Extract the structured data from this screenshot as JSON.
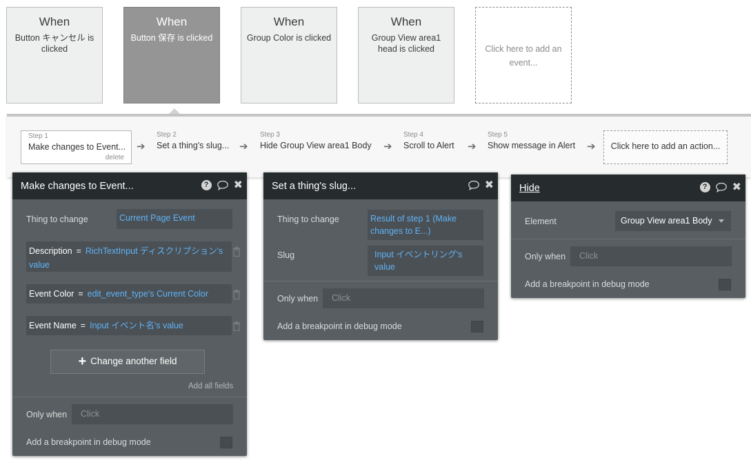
{
  "events": [
    {
      "when": "When",
      "desc": "Button キャンセル is clicked"
    },
    {
      "when": "When",
      "desc": "Button 保存 is clicked"
    },
    {
      "when": "When",
      "desc": "Group Color is clicked"
    },
    {
      "when": "When",
      "desc": "Group View area1 head is clicked"
    },
    {
      "when": "",
      "desc": "Click here to add an event..."
    }
  ],
  "steps": [
    {
      "num": "Step 1",
      "title": "Make changes to Event...",
      "delete": "delete"
    },
    {
      "num": "Step 2",
      "title": "Set a thing's slug..."
    },
    {
      "num": "Step 3",
      "title": "Hide Group View area1 Body"
    },
    {
      "num": "Step 4",
      "title": "Scroll to Alert"
    },
    {
      "num": "Step 5",
      "title": "Show message in Alert"
    }
  ],
  "add_action": "Click here to add an action...",
  "icons": {
    "help": "?",
    "close": "✖",
    "arrow": "➔",
    "plus": "+"
  },
  "panel1": {
    "title": "Make changes to Event...",
    "thing_label": "Thing to change",
    "thing_value": "Current Page Event",
    "fields": [
      {
        "name": "Description",
        "eq": "=",
        "value": "RichTextInput ディスクリプション's value"
      },
      {
        "name": "Event Color",
        "eq": "=",
        "value": "edit_event_type's Current Color"
      },
      {
        "name": "Event Name",
        "eq": "=",
        "value": "Input イベント名's value"
      }
    ],
    "change_btn": "Change another field",
    "add_all": "Add all fields",
    "only_when_label": "Only when",
    "only_when_placeholder": "Click",
    "breakpoint_label": "Add a breakpoint in debug mode"
  },
  "panel2": {
    "title": "Set a thing's slug...",
    "thing_label": "Thing to change",
    "thing_value": "Result of step 1 (Make changes to E...)",
    "slug_label": "Slug",
    "slug_value": "Input イベントリング's value",
    "only_when_label": "Only when",
    "only_when_placeholder": "Click",
    "breakpoint_label": "Add a breakpoint in debug mode"
  },
  "panel3": {
    "title": "Hide",
    "element_label": "Element",
    "element_value": "Group View area1 Body",
    "only_when_label": "Only when",
    "only_when_placeholder": "Click",
    "breakpoint_label": "Add a breakpoint in debug mode"
  }
}
